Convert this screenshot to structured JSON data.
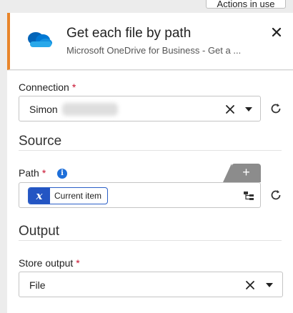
{
  "top": {
    "actions_button": "Actions in use"
  },
  "header": {
    "title": "Get each file by path",
    "subtitle": "Microsoft OneDrive for Business - Get a ...",
    "accent_color": "#e8852a",
    "icon": "onedrive-cloud-icon"
  },
  "connection": {
    "label": "Connection",
    "required_mark": "*",
    "value": "Simon"
  },
  "source": {
    "heading": "Source",
    "path_label": "Path",
    "required_mark": "*",
    "info_glyph": "i",
    "add_glyph": "+",
    "token_glyph": "x",
    "token_label": "Current item"
  },
  "output": {
    "heading": "Output",
    "store_label": "Store output",
    "required_mark": "*",
    "value": "File"
  },
  "colors": {
    "required": "#c8102e",
    "info": "#1e6fd9",
    "token": "#2455c3"
  }
}
